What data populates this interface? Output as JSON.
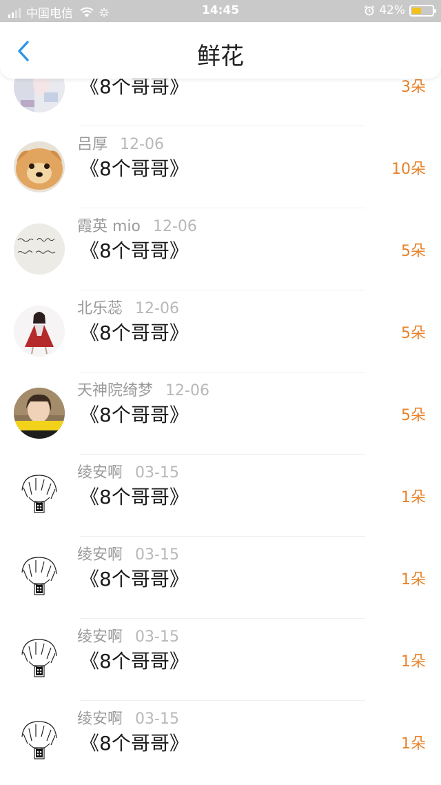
{
  "status_bar": {
    "carrier": "中国电信",
    "time": "14:45",
    "battery": "42%",
    "battery_level": 0.42,
    "battery_color": "#f3c11b"
  },
  "nav": {
    "back_icon": "chevron-left-icon",
    "title": "鲜花",
    "accent_color": "#2f94e8"
  },
  "rows": [
    {
      "user": "",
      "date": "",
      "work": "《8个哥哥》",
      "flowers": "3朵",
      "avatar": "partial-photo"
    },
    {
      "user": "吕厚",
      "date": "12-06",
      "work": "《8个哥哥》",
      "flowers": "10朵",
      "avatar": "pomeranian-dog"
    },
    {
      "user": "霞英 mio",
      "date": "12-06",
      "work": "《8个哥哥》",
      "flowers": "5朵",
      "avatar": "handwriting"
    },
    {
      "user": "北乐蕊",
      "date": "12-06",
      "work": "《8个哥哥》",
      "flowers": "5朵",
      "avatar": "anime-girl-red-dress"
    },
    {
      "user": "天神院绮梦",
      "date": "12-06",
      "work": "《8个哥哥》",
      "flowers": "5朵",
      "avatar": "photo-girl"
    },
    {
      "user": "绫安啊",
      "date": "03-15",
      "work": "《8个哥哥》",
      "flowers": "1朵",
      "avatar": "sketch-character"
    },
    {
      "user": "绫安啊",
      "date": "03-15",
      "work": "《8个哥哥》",
      "flowers": "1朵",
      "avatar": "sketch-character"
    },
    {
      "user": "绫安啊",
      "date": "03-15",
      "work": "《8个哥哥》",
      "flowers": "1朵",
      "avatar": "sketch-character"
    },
    {
      "user": "绫安啊",
      "date": "03-15",
      "work": "《8个哥哥》",
      "flowers": "1朵",
      "avatar": "sketch-character"
    }
  ],
  "colors": {
    "flower_count": "#e8822a",
    "username": "#9b9b9b",
    "date": "#b8b8b8",
    "status_bar": "#c9c9c9"
  }
}
